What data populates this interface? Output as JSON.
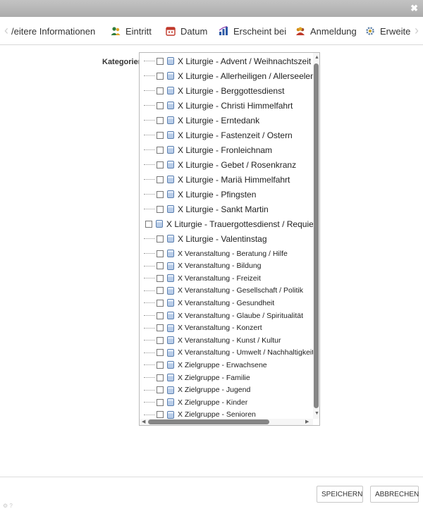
{
  "window": {
    "close_glyph": "✖"
  },
  "tabs": {
    "scroll_left": "‹",
    "scroll_right": "›",
    "items": [
      {
        "label": "/eitere Informationen",
        "icon": ""
      },
      {
        "label": "Eintritt",
        "icon": "people-icon"
      },
      {
        "label": "Datum",
        "icon": "calendar-icon"
      },
      {
        "label": "Erscheint bei",
        "icon": "chart-icon"
      },
      {
        "label": "Anmeldung",
        "icon": "group-icon"
      },
      {
        "label": "Erweite",
        "icon": "gear-icon"
      }
    ]
  },
  "form": {
    "categories_label": "Kategorien:",
    "categories": [
      "X Liturgie - Advent / Weihnachtszeit",
      "X Liturgie - Allerheiligen / Allerseelen",
      "X Liturgie - Berggottesdienst",
      "X Liturgie - Christi Himmelfahrt",
      "X Liturgie - Erntedank",
      "X Liturgie - Fastenzeit / Ostern",
      "X Liturgie - Fronleichnam",
      "X Liturgie - Gebet / Rosenkranz",
      "X Liturgie - Mariä Himmelfahrt",
      "X Liturgie - Pfingsten",
      "X Liturgie - Sankt Martin",
      "X Liturgie - Trauergottesdienst / Requiem /",
      "X Liturgie - Valentinstag",
      "X Veranstaltung - Beratung / Hilfe",
      "X Veranstaltung - Bildung",
      "X Veranstaltung - Freizeit",
      "X Veranstaltung - Gesellschaft / Politik",
      "X Veranstaltung - Gesundheit",
      "X Veranstaltung - Glaube / Spiritualität",
      "X Veranstaltung - Konzert",
      "X Veranstaltung - Kunst / Kultur",
      "X Veranstaltung - Umwelt / Nachhaltigkeit",
      "X Zielgruppe - Erwachsene",
      "X Zielgruppe - Familie",
      "X Zielgruppe - Jugend",
      "X Zielgruppe - Kinder",
      "X Zielgruppe - Senioren"
    ]
  },
  "footer": {
    "save_label": "SPEICHERN",
    "cancel_label": "ABBRECHEN",
    "corner_mark": "⚙ ?"
  },
  "colors": {
    "titlebar": "#b8b8b8",
    "people": "#2f7d3b",
    "calendar": "#c0392b",
    "chart": "#2d5aa6",
    "group": "#d18a16",
    "gear": "#5c7fa8"
  }
}
